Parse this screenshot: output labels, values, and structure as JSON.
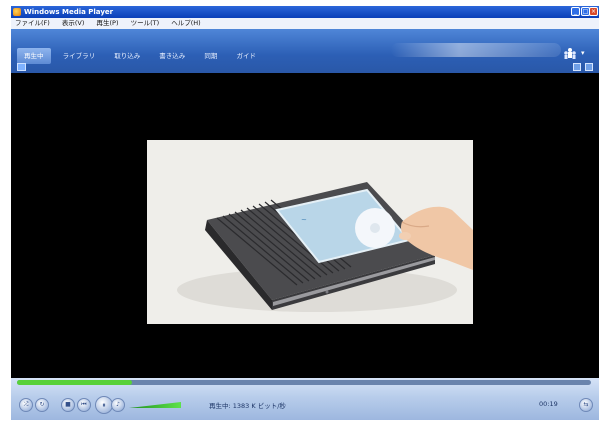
{
  "window": {
    "title": "Windows Media Player",
    "buttons": [
      "minimize",
      "maximize",
      "close"
    ]
  },
  "menu": {
    "items": [
      "ファイル(F)",
      "表示(V)",
      "再生(P)",
      "ツール(T)",
      "ヘルプ(H)"
    ]
  },
  "nav": {
    "tabs": [
      {
        "label": "再生中",
        "active": true
      },
      {
        "label": "ライブラリ",
        "active": false
      },
      {
        "label": "取り込み",
        "active": false
      },
      {
        "label": "書き込み",
        "active": false
      },
      {
        "label": "同期",
        "active": false
      },
      {
        "label": "ガイド",
        "active": false
      }
    ],
    "search_placeholder": ""
  },
  "playback": {
    "status": "再生中: 1383 K ビット/秒",
    "time": "00:19",
    "seek_progress": 0.2,
    "volume_level": 0.85
  },
  "colors": {
    "nav_bar": "#2c5fb5",
    "seek_fill": "#58d13a"
  },
  "icons": {
    "app": "wmp-logo-icon",
    "people": "online-stores-icon"
  }
}
